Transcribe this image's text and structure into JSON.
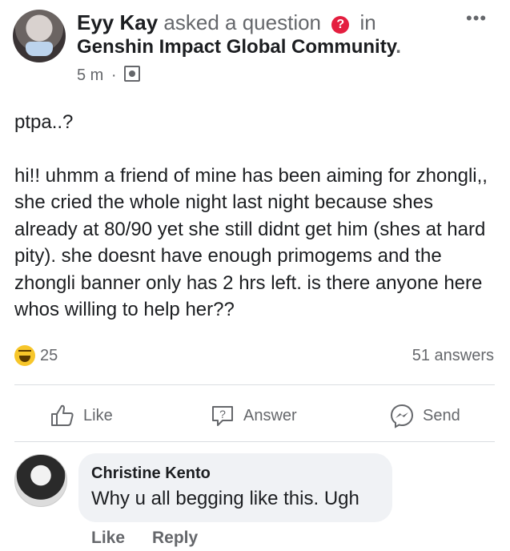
{
  "post": {
    "author": "Eyy Kay",
    "action_text": "asked a question",
    "in_text": "in",
    "group": "Genshin Impact Global Community",
    "group_suffix": ".",
    "time": "5 m",
    "separator": "·",
    "question_icon": "question-icon",
    "more_label": "•••",
    "title": "ptpa..?",
    "body": "hi!! uhmm a friend of mine has been aiming for zhongli,, she cried the whole night last night because shes already at 80/90 yet she still didnt get him (shes at hard pity). she doesnt have enough primogems and the zhongli banner only has 2 hrs left. is there anyone here whos willing to help her??",
    "reaction_count": "25",
    "answers": "51 answers"
  },
  "actions": {
    "like": "Like",
    "answer": "Answer",
    "send": "Send"
  },
  "comment": {
    "author": "Christine Kento",
    "text": "Why u all begging like this. Ugh",
    "like": "Like",
    "reply": "Reply"
  },
  "colors": {
    "text": "#1c1e21",
    "muted": "#65676b",
    "bubble": "#f0f2f5",
    "question_badge": "#e41e3f",
    "reaction": "#f7c62a"
  }
}
